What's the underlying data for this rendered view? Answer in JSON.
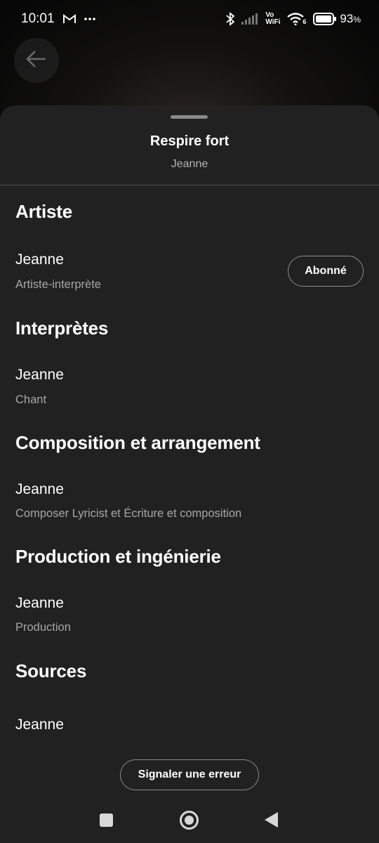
{
  "status_bar": {
    "time": "10:01",
    "battery_percent": "93",
    "battery_sign": "%",
    "icons": [
      "gmail-icon",
      "more-dots-icon",
      "bluetooth-icon",
      "signal-icon",
      "vowifi-icon",
      "wifi-icon",
      "battery-icon"
    ],
    "vowifi_label_top": "Vo",
    "vowifi_label_bottom": "WiFi",
    "wifi_badge": "6"
  },
  "top_bar": {
    "back_icon": "arrow-left-icon"
  },
  "sheet": {
    "title": "Respire fort",
    "subtitle": "Jeanne"
  },
  "sections": [
    {
      "title": "Artiste",
      "people": [
        {
          "name": "Jeanne",
          "role": "Artiste-interprète",
          "action_label": "Abonné"
        }
      ]
    },
    {
      "title": "Interprètes",
      "people": [
        {
          "name": "Jeanne",
          "role": "Chant"
        }
      ]
    },
    {
      "title": "Composition et arrangement",
      "people": [
        {
          "name": "Jeanne",
          "role": "Composer Lyricist et Écriture et composition"
        }
      ]
    },
    {
      "title": "Production et ingénierie",
      "people": [
        {
          "name": "Jeanne",
          "role": "Production"
        }
      ]
    },
    {
      "title": "Sources",
      "people": [
        {
          "name": "Jeanne"
        }
      ]
    }
  ],
  "report_button_label": "Signaler une erreur",
  "nav_bar": {
    "icons": [
      "recents-square-icon",
      "home-circle-icon",
      "back-triangle-icon"
    ]
  },
  "colors": {
    "sheet_background": "#212121",
    "secondary_text": "#a7a7a7",
    "button_border": "#8c8c8c"
  }
}
